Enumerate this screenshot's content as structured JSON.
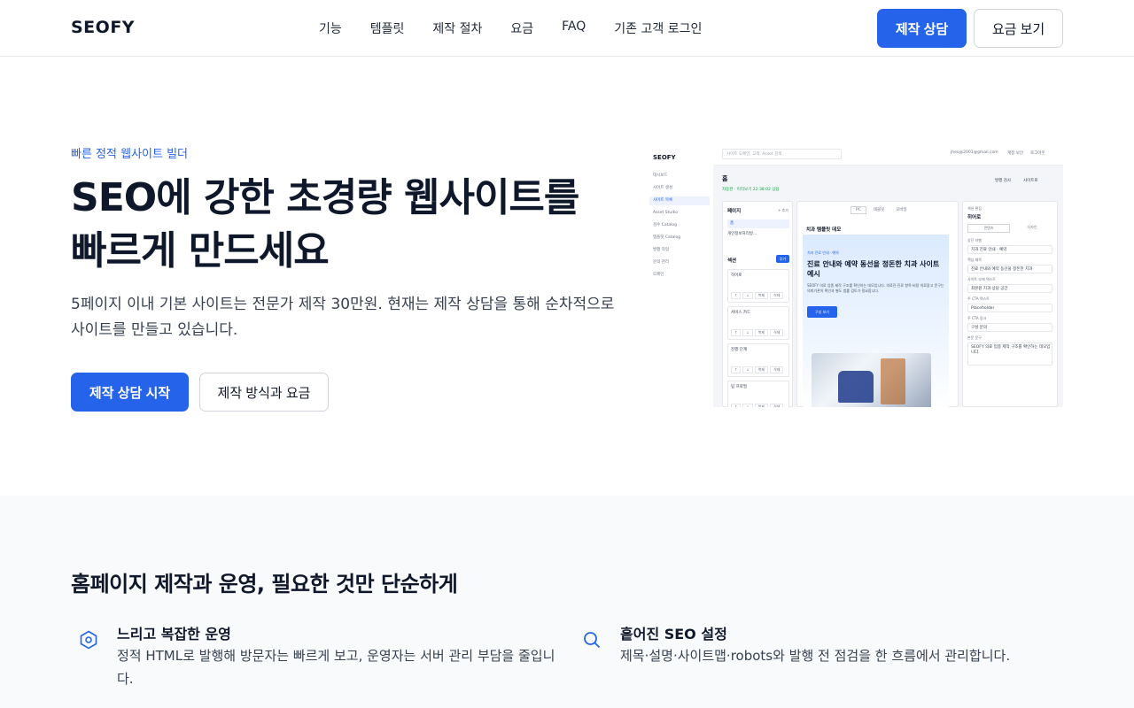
{
  "header": {
    "logo": "SEOFY",
    "nav": [
      "기능",
      "템플릿",
      "제작 절차",
      "요금",
      "FAQ",
      "기존 고객 로그인"
    ],
    "consult_button": "제작 상담",
    "pricing_button": "요금 보기"
  },
  "hero": {
    "eyebrow": "빠른 정적 웹사이트 빌더",
    "title": "SEO에 강한 초경량 웹사이트를 빠르게 만드세요",
    "description": "5페이지 이내 기본 사이트는 전문가 제작 30만원. 현재는 제작 상담을 통해 순차적으로 사이트를 만들고 있습니다.",
    "primary_cta": "제작 상담 시작",
    "secondary_cta": "제작 방식과 요금"
  },
  "mock": {
    "logo": "SEOFY",
    "search_placeholder": "사이트 도메인, 고객, Asset 검색",
    "user_email": "jheo@2001@gmail.com",
    "top_actions": [
      "계정 보안",
      "로그아웃"
    ],
    "side_items": [
      "대시보드",
      "사이트 생성",
      "사이트 목록",
      "Asset Studio",
      "검수 Catalog",
      "템플릿 Catalog",
      "발행 작업",
      "문의 관리",
      "도메인"
    ],
    "active_side_item": "사이트 목록",
    "page_label": "홈",
    "status": "자동완 · 미리보기 22:38:02 상담",
    "toolbar": [
      "발행 검사",
      "사이트로"
    ],
    "pages_title": "페이지",
    "pages_add": "+ 추가",
    "pages": [
      "홈",
      "개인정보처리방..."
    ],
    "sections_title": "섹션",
    "sections_add": "추가",
    "sections": [
      "히어로",
      "서비스 카드",
      "진행 단계",
      "팀 프로필"
    ],
    "section_actions": [
      "↑",
      "↓",
      "복제",
      "삭제"
    ],
    "device_tabs": [
      "PC",
      "태블릿",
      "모바일"
    ],
    "preview_site_title": "치과 템플릿 데모",
    "preview_eyebrow": "치과 진료 안내 · 예약",
    "preview_title": "진료 안내와 예약 동선을 정돈한 치과 사이트 예시",
    "preview_text": "SEOFY 의료 업종 제작 구조를 확인하는 데모입니다. 의료진·진료 항목·비용 의료광고 문구는 의뢰기관의 확인과 별도 법률 검토가 필요합니다.",
    "preview_button": "구성 보기",
    "panel_title": "섹션 편집",
    "panel_section": "히어로",
    "panel_tabs": [
      "콘텐츠",
      "디자인"
    ],
    "fields": [
      {
        "label": "상단 라벨",
        "value": "치과 진료 안내 · 예약"
      },
      {
        "label": "핵심 제목",
        "value": "진료 안내와 예약 동선을 정돈한 치과"
      },
      {
        "label": "사이트 부제 텍스트",
        "value": "최본원 치과 상담 공간"
      },
      {
        "label": "주 CTA 텍스트",
        "value": "Placeholder"
      },
      {
        "label": "주 CTA 링크",
        "value": "구성 문의"
      },
      {
        "label": "본문 문구",
        "value": "SEOFY 의료 업종 제작 구조를 확인하는 데모입니다."
      }
    ]
  },
  "features": {
    "title": "홈페이지 제작과 운영, 필요한 것만 단순하게",
    "items": [
      {
        "icon": "hexagon-icon",
        "heading": "느리고 복잡한 운영",
        "text": "정적 HTML로 발행해 방문자는 빠르게 보고, 운영자는 서버 관리 부담을 줄입니다."
      },
      {
        "icon": "search-icon",
        "heading": "흩어진 SEO 설정",
        "text": "제목·설명·사이트맵·robots와 발행 전 점검을 한 흐름에서 관리합니다."
      }
    ]
  },
  "colors": {
    "accent": "#2563eb",
    "text": "#0f172a",
    "section_bg": "#f8fafc"
  }
}
